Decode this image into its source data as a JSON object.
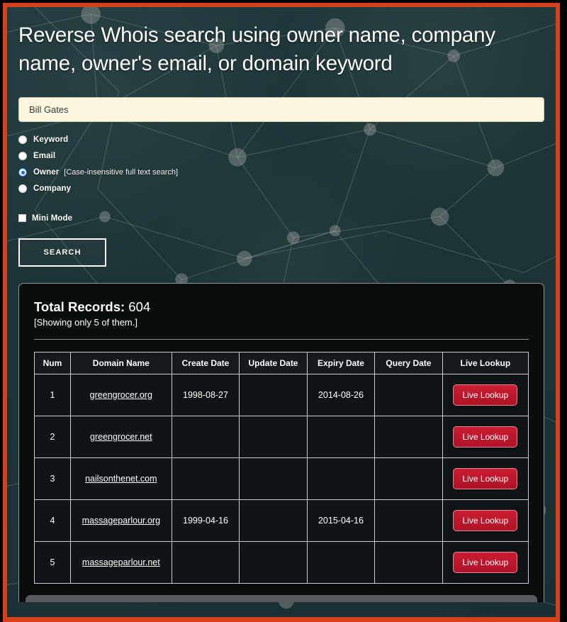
{
  "page": {
    "title": "Reverse Whois search using owner name, company name, owner's email, or domain keyword",
    "accent_border_color": "#d6411c",
    "background_color": "#1e3538"
  },
  "search": {
    "value": "Bill Gates",
    "placeholder": "",
    "button_label": "SEARCH"
  },
  "options": {
    "items": [
      {
        "label": "Keyword",
        "note": "",
        "selected": false
      },
      {
        "label": "Email",
        "note": "",
        "selected": false
      },
      {
        "label": "Owner",
        "note": "[Case-insensitive full text search]",
        "selected": true
      },
      {
        "label": "Company",
        "note": "",
        "selected": false
      }
    ],
    "mini_mode": {
      "label": "Mini Mode",
      "checked": false
    }
  },
  "results": {
    "total_label": "Total Records:",
    "total_count": "604",
    "showing_note": "[Showing only 5 of them.]",
    "columns": [
      "Num",
      "Domain Name",
      "Create Date",
      "Update Date",
      "Expiry Date",
      "Query Date",
      "Live Lookup"
    ],
    "live_lookup_label": "Live Lookup",
    "rows": [
      {
        "num": "1",
        "domain": "greengrocer.org",
        "create": "1998-08-27",
        "update": "",
        "expiry": "2014-08-26",
        "query": ""
      },
      {
        "num": "2",
        "domain": "greengrocer.net",
        "create": "",
        "update": "",
        "expiry": "",
        "query": ""
      },
      {
        "num": "3",
        "domain": "nailsonthenet.com",
        "create": "",
        "update": "",
        "expiry": "",
        "query": ""
      },
      {
        "num": "4",
        "domain": "massageparlour.org",
        "create": "1999-04-16",
        "update": "",
        "expiry": "2015-04-16",
        "query": ""
      },
      {
        "num": "5",
        "domain": "massageparlour.net",
        "create": "",
        "update": "",
        "expiry": "",
        "query": ""
      }
    ]
  }
}
